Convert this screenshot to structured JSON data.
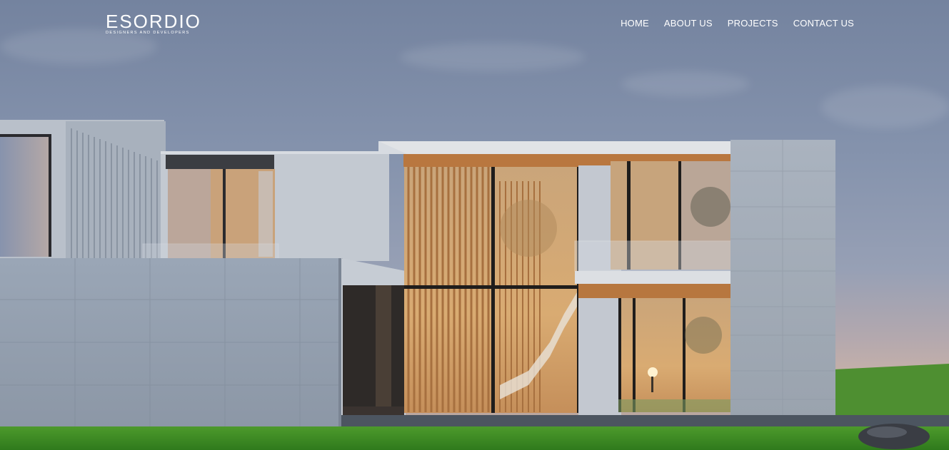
{
  "brand": {
    "name": "ESORDIO",
    "tagline": "DESIGNERS AND DEVELOPERS"
  },
  "nav": {
    "items": [
      {
        "label": "HOME"
      },
      {
        "label": "ABOUT US"
      },
      {
        "label": "PROJECTS"
      },
      {
        "label": "CONTACT US"
      }
    ]
  },
  "hero": {
    "image": "modern-house-render",
    "colors": {
      "sky_top": "#74839f",
      "sky_horizon": "#c9b2a8",
      "grass": "#3f8a26",
      "wall": "#b7bec8",
      "wood": "#c8874a",
      "window_glow": "#e6b77a"
    }
  }
}
